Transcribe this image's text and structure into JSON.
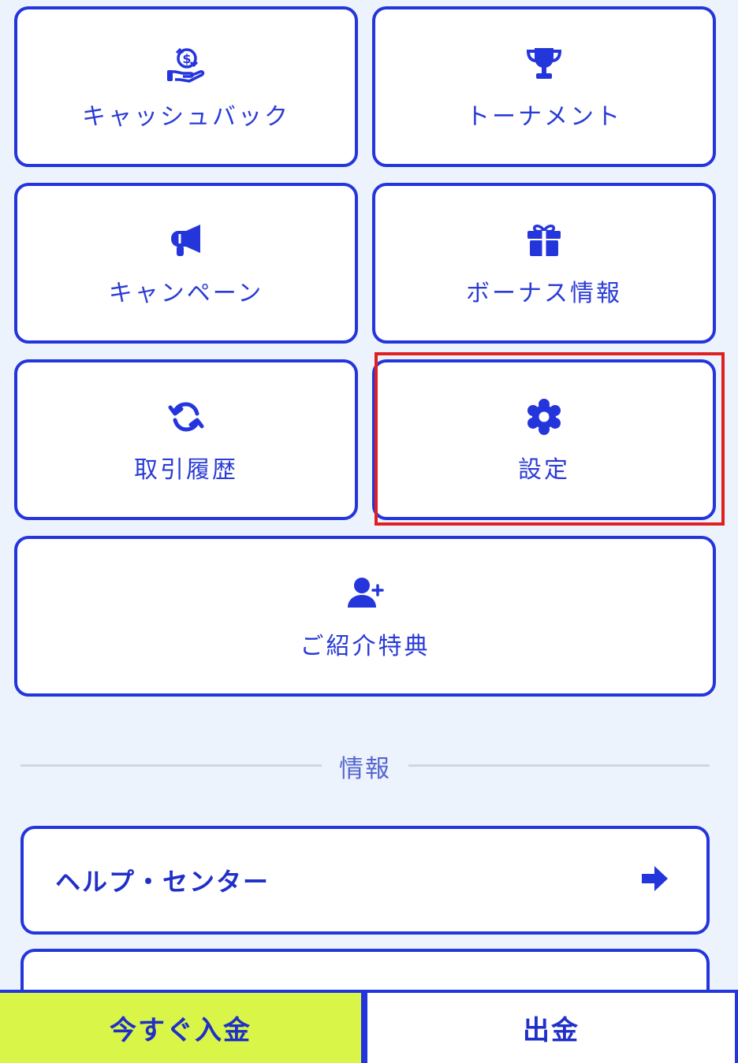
{
  "menu": {
    "cashback": {
      "label": "キャッシュバック",
      "icon": "cashback-hand-icon"
    },
    "tournament": {
      "label": "トーナメント",
      "icon": "trophy-icon"
    },
    "campaign": {
      "label": "キャンペーン",
      "icon": "megaphone-icon"
    },
    "bonus": {
      "label": "ボーナス情報",
      "icon": "gift-icon"
    },
    "history": {
      "label": "取引履歴",
      "icon": "refresh-arrows-icon"
    },
    "settings": {
      "label": "設定",
      "icon": "gear-icon"
    },
    "referral": {
      "label": "ご紹介特典",
      "icon": "user-plus-icon"
    }
  },
  "info_section": {
    "heading": "情報",
    "links": [
      {
        "label": "ヘルプ・センター",
        "icon": "arrow-right-icon"
      }
    ]
  },
  "bottom_bar": {
    "deposit_label": "今すぐ入金",
    "withdraw_label": "出金"
  },
  "colors": {
    "accent": "#2435dc",
    "background": "#edf3fd",
    "deposit_bg": "#d8f548",
    "highlight": "#e02020"
  }
}
